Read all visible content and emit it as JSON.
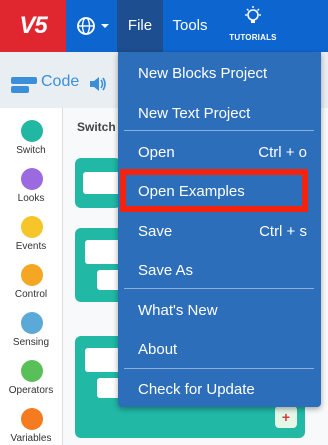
{
  "topbar": {
    "logo": "V5",
    "file_label": "File",
    "tools_label": "Tools",
    "tutorials_label": "TUTORIALS"
  },
  "code_tab": {
    "label": "Code"
  },
  "categories": [
    {
      "label": "Switch",
      "color": "#22b7a3"
    },
    {
      "label": "Looks",
      "color": "#9b6ae0"
    },
    {
      "label": "Events",
      "color": "#f5c52a"
    },
    {
      "label": "Control",
      "color": "#f5a623"
    },
    {
      "label": "Sensing",
      "color": "#5aa9d6"
    },
    {
      "label": "Operators",
      "color": "#59c059"
    },
    {
      "label": "Variables",
      "color": "#f47b20"
    }
  ],
  "workspace": {
    "title": "Switch"
  },
  "file_menu": {
    "items": [
      {
        "label": "New Blocks Project",
        "shortcut": ""
      },
      {
        "label": "New Text Project",
        "shortcut": ""
      },
      {
        "label": "Open",
        "shortcut": "Ctrl + o"
      },
      {
        "label": "Open Examples",
        "shortcut": ""
      },
      {
        "label": "Save",
        "shortcut": "Ctrl + s"
      },
      {
        "label": "Save As",
        "shortcut": ""
      },
      {
        "label": "What's New",
        "shortcut": ""
      },
      {
        "label": "About",
        "shortcut": ""
      },
      {
        "label": "Check for Update",
        "shortcut": ""
      }
    ]
  },
  "colors": {
    "topbar": "#0d66d0",
    "logo_bg": "#e0262f",
    "menu_bg": "#2d6ebb",
    "highlight": "#f5220d",
    "block": "#21b8a6"
  }
}
